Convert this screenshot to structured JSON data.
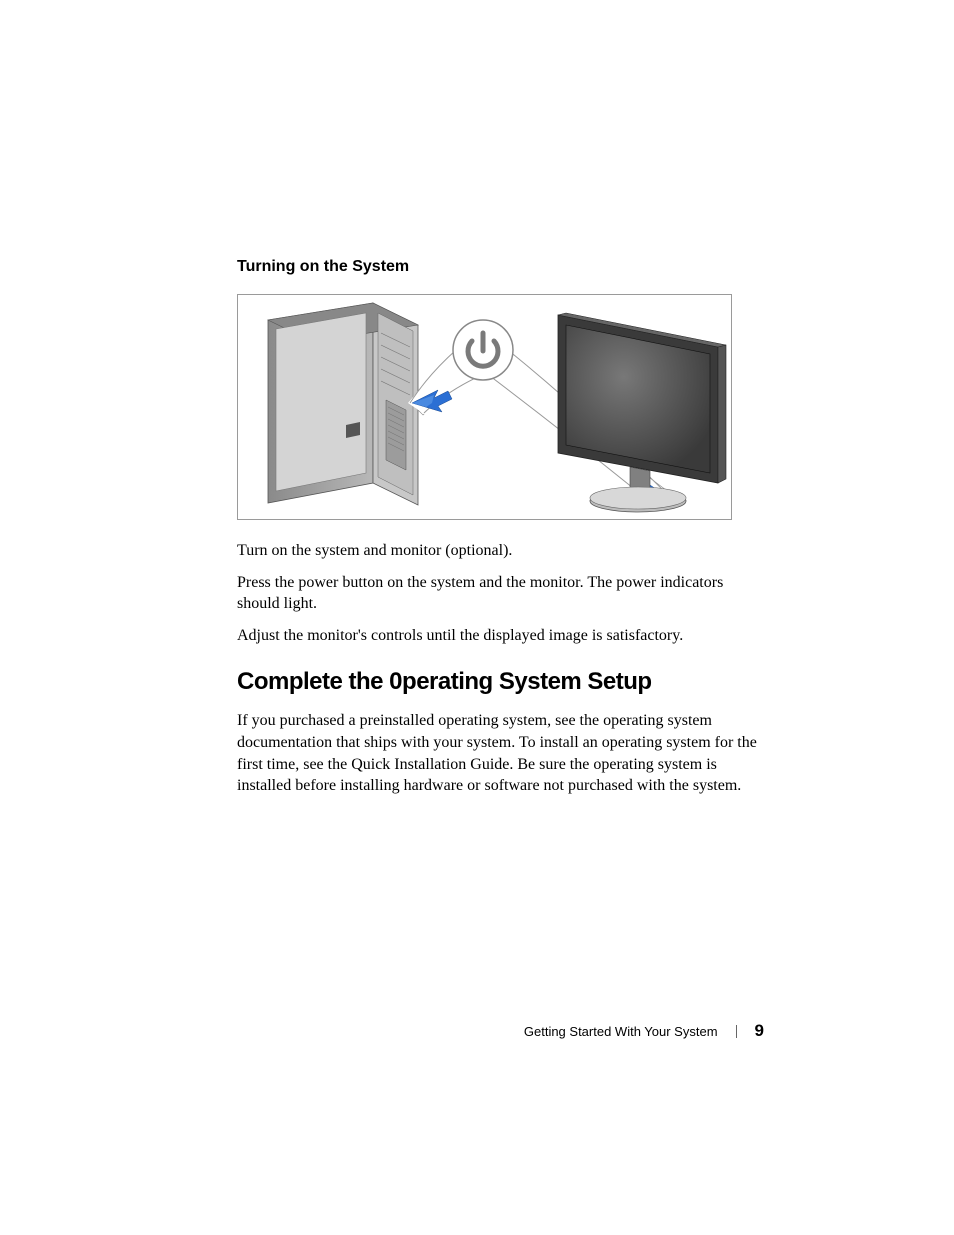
{
  "section_heading": "Turning on the System",
  "paragraphs": {
    "p1": "Turn on the system and monitor (optional).",
    "p2": "Press the power button on the system and the monitor. The power indicators should light.",
    "p3": "Adjust the monitor's controls until the displayed image is satisfactory."
  },
  "main_heading": "Complete the 0perating System Setup",
  "main_body": "If you purchased a preinstalled operating system, see the operating system documentation that ships with your system. To install an operating system for the first time, see the Quick Installation Guide. Be sure the operating system is installed before installing hardware or software not purchased with the system.",
  "footer": {
    "label": "Getting Started With Your System",
    "page_number": "9"
  }
}
